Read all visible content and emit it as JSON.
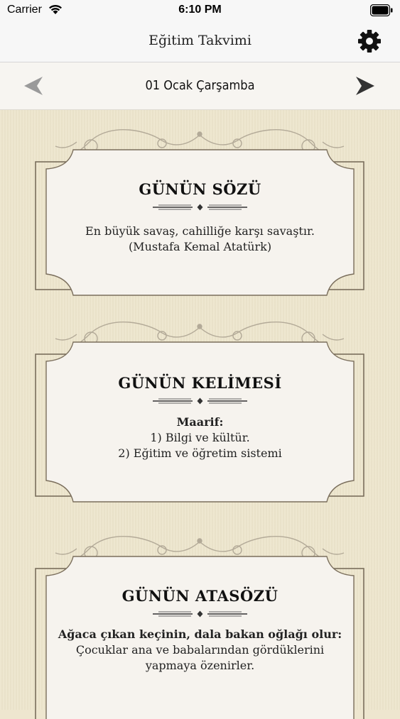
{
  "status_bar": {
    "carrier": "Carrier",
    "time": "6:10 PM"
  },
  "nav": {
    "title": "Eğitim Takvimi",
    "settings_icon": "gear-icon"
  },
  "date_nav": {
    "date": "01 Ocak Çarşamba",
    "prev_icon": "chevron-left-icon",
    "next_icon": "chevron-right-icon"
  },
  "cards": {
    "quote": {
      "title": "GÜNÜN SÖZÜ",
      "line1": "En büyük savaş, cahilliğe karşı savaştır.",
      "line2": "(Mustafa Kemal Atatürk)"
    },
    "word": {
      "title": "GÜNÜN KELİMESİ",
      "term": "Maarif:",
      "def1": "1) Bilgi ve kültür.",
      "def2": "2) Eğitim ve öğretim sistemi"
    },
    "proverb": {
      "title": "GÜNÜN ATASÖZÜ",
      "saying": "Ağaca çıkan keçinin, dala bakan oğlağı olur:",
      "meaning1": "Çocuklar ana ve babalarından gördüklerini",
      "meaning2": "yapmaya özenirler."
    }
  },
  "colors": {
    "frame": "#7a6e5c",
    "card_bg": "#f6f3ee",
    "page_bg": "#ede5cc"
  }
}
